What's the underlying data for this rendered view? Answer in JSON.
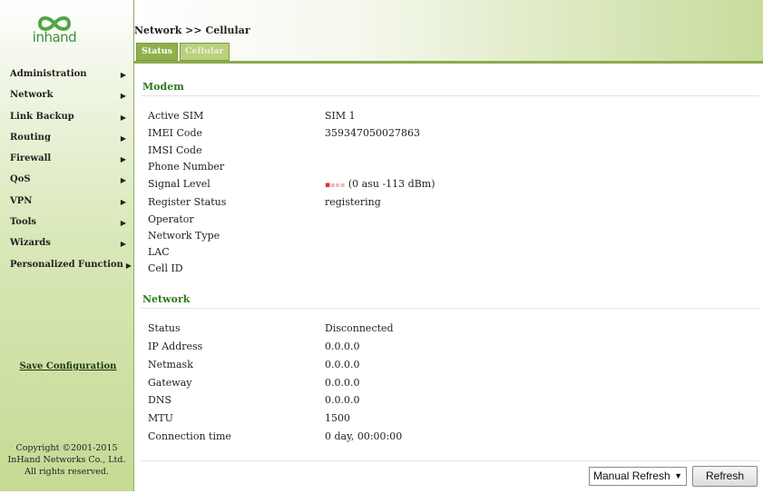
{
  "brand": {
    "logo_text": "inhand",
    "logo_icon": "infinity-logo-icon"
  },
  "sidebar": {
    "items": [
      {
        "label": "Administration"
      },
      {
        "label": "Network"
      },
      {
        "label": "Link Backup"
      },
      {
        "label": "Routing"
      },
      {
        "label": "Firewall"
      },
      {
        "label": "QoS"
      },
      {
        "label": "VPN"
      },
      {
        "label": "Tools"
      },
      {
        "label": "Wizards"
      },
      {
        "label": "Personalized Function"
      }
    ],
    "arrow_glyph": "▶",
    "save_label": "Save Configuration",
    "copyright": [
      "Copyright ©2001-2015",
      "InHand Networks Co., Ltd.",
      "All rights reserved."
    ]
  },
  "header": {
    "breadcrumb": "Network >> Cellular",
    "tabs": [
      {
        "label": "Status",
        "active": true
      },
      {
        "label": "Cellular",
        "active": false
      }
    ]
  },
  "modem": {
    "title": "Modem",
    "rows": [
      {
        "label": "Active SIM",
        "value": "SIM 1"
      },
      {
        "label": "IMEI Code",
        "value": "359347050027863"
      },
      {
        "label": "IMSI Code",
        "value": ""
      },
      {
        "label": "Phone Number",
        "value": ""
      },
      {
        "label": "Signal Level",
        "value": "(0 asu -113 dBm)"
      },
      {
        "label": "Register Status",
        "value": "registering"
      },
      {
        "label": "Operator",
        "value": ""
      },
      {
        "label": "Network Type",
        "value": ""
      },
      {
        "label": "LAC",
        "value": ""
      },
      {
        "label": "Cell ID",
        "value": ""
      }
    ],
    "signal_bars": 0,
    "signal_icon": "signal-bars-icon"
  },
  "network": {
    "title": "Network",
    "rows": [
      {
        "label": "Status",
        "value": "Disconnected"
      },
      {
        "label": "IP Address",
        "value": "0.0.0.0"
      },
      {
        "label": "Netmask",
        "value": "0.0.0.0"
      },
      {
        "label": "Gateway",
        "value": "0.0.0.0"
      },
      {
        "label": "DNS",
        "value": "0.0.0.0"
      },
      {
        "label": "MTU",
        "value": "1500"
      },
      {
        "label": "Connection time",
        "value": "0 day, 00:00:00"
      }
    ]
  },
  "footer": {
    "refresh_mode": "Manual Refresh",
    "refresh_label": "Refresh"
  },
  "colors": {
    "accent_green": "#2f7a1d",
    "tab_active": "#8fb04c",
    "signal_red": "#d9312b"
  }
}
